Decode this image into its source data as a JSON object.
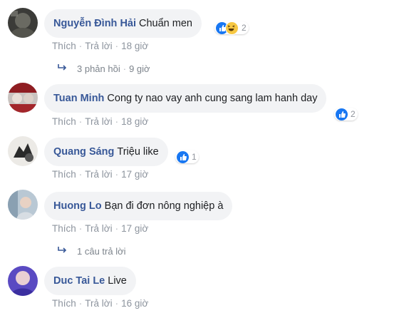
{
  "colors": {
    "author": "#385898",
    "bubble": "#f2f3f5",
    "meta": "#8d949e",
    "like": "#1877f2",
    "haha": "#f7c843"
  },
  "comments": [
    {
      "author": "Nguyễn Đình Hải",
      "text": "Chuẩn men",
      "reactions": [
        "like-icon",
        "haha-icon"
      ],
      "reaction_count": "2",
      "actions": {
        "like": "Thích",
        "reply": "Trả lời",
        "time": "18 giờ"
      },
      "replies": {
        "label": "3 phản hồi",
        "time": "9 giờ"
      }
    },
    {
      "author": "Tuan Minh",
      "text": "Cong ty nao vay anh cung sang lam hanh day",
      "reactions": [
        "like-icon"
      ],
      "reaction_count": "2",
      "actions": {
        "like": "Thích",
        "reply": "Trả lời",
        "time": "18 giờ"
      }
    },
    {
      "author": "Quang Sáng",
      "text": "Triệu like",
      "reactions": [
        "like-icon"
      ],
      "reaction_count": "1",
      "actions": {
        "like": "Thích",
        "reply": "Trả lời",
        "time": "17 giờ"
      }
    },
    {
      "author": "Huong Lo",
      "text": "Bạn đi đơn nông nghiệp à",
      "actions": {
        "like": "Thích",
        "reply": "Trả lời",
        "time": "17 giờ"
      },
      "replies": {
        "label": "1 câu trả lời"
      }
    },
    {
      "author": "Duc Tai Le",
      "text": "Live",
      "actions": {
        "like": "Thích",
        "reply": "Trả lời",
        "time": "16 giờ"
      }
    }
  ]
}
